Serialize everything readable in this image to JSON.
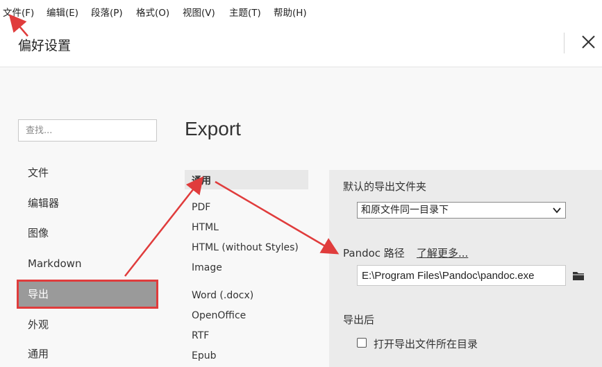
{
  "menubar": {
    "items": [
      "文件(F)",
      "编辑(E)",
      "段落(P)",
      "格式(O)",
      "视图(V)",
      "主题(T)",
      "帮助(H)"
    ]
  },
  "header": {
    "title": "偏好设置"
  },
  "sidebar": {
    "search_placeholder": "查找...",
    "items": [
      "文件",
      "编辑器",
      "图像",
      "Markdown",
      "导出",
      "外观",
      "通用"
    ],
    "active": "导出"
  },
  "main": {
    "section_title": "Export",
    "subnav": [
      "通用",
      "PDF",
      "HTML",
      "HTML (without Styles)",
      "Image",
      "Word (.docx)",
      "OpenOffice",
      "RTF",
      "Epub"
    ],
    "subnav_active": "通用"
  },
  "settings": {
    "default_folder_label": "默认的导出文件夹",
    "default_folder_value": "和原文件同一目录下",
    "pandoc_label": "Pandoc 路径",
    "pandoc_link": "了解更多...",
    "pandoc_path": "E:\\Program Files\\Pandoc\\pandoc.exe",
    "after_export_label": "导出后",
    "open_folder_label": "打开导出文件所在目录",
    "open_folder_checked": false
  },
  "colors": {
    "annotation_red": "#e03c3c",
    "active_nav_bg": "#9a9a9a"
  }
}
